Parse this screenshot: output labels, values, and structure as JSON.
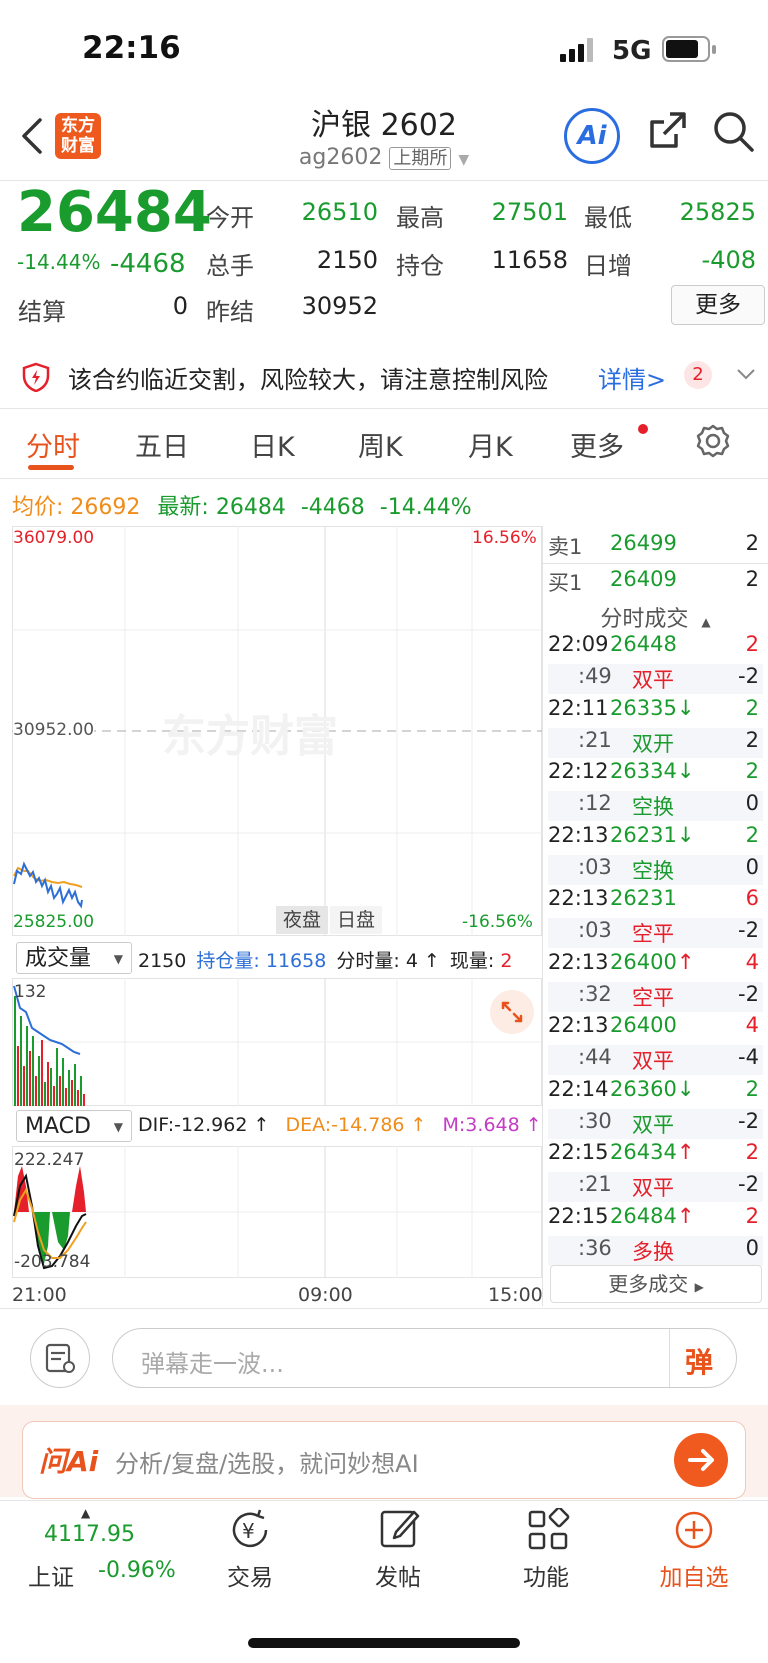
{
  "status_bar": {
    "time": "22:16",
    "network": "5G"
  },
  "header": {
    "logo_text_1": "东方",
    "logo_text_2": "财富",
    "title": "沪银 2602",
    "code": "ag2602",
    "exchange": "上期所",
    "ai_label": "Ai"
  },
  "quote": {
    "price": "26484",
    "change_pct": "-14.44%",
    "change": "-4468",
    "rows": [
      [
        {
          "label": "今开",
          "value": "26510",
          "color": "#1a9b2e"
        },
        {
          "label": "最高",
          "value": "27501",
          "color": "#1a9b2e"
        },
        {
          "label": "最低",
          "value": "25825",
          "color": "#1a9b2e"
        }
      ],
      [
        {
          "label": "总手",
          "value": "2150",
          "color": "#222"
        },
        {
          "label": "持仓",
          "value": "11658",
          "color": "#222"
        },
        {
          "label": "日增",
          "value": "-408",
          "color": "#1a9b2e"
        }
      ]
    ],
    "settle_label": "结算",
    "settle_value": "0",
    "prev_settle_label": "昨结",
    "prev_settle_value": "30952",
    "more_label": "更多"
  },
  "warning": {
    "text": "该合约临近交割，风险较大，请注意控制风险",
    "link": "详情>",
    "badge": "2"
  },
  "tabs": [
    "分时",
    "五日",
    "日K",
    "周K",
    "月K",
    "更多"
  ],
  "info_line": {
    "avg_label": "均价:",
    "avg_value": "26692",
    "latest_label": "最新:",
    "latest_value": "26484",
    "change": "-4468",
    "change_pct": "-14.44%"
  },
  "chart": {
    "max_label": "36079.00",
    "mid_label": "30952.00",
    "min_label": "25825.00",
    "max_pct": "16.56%",
    "min_pct": "-16.56%",
    "watermark": "东方财富",
    "night_label": "夜盘",
    "day_label": "日盘",
    "volume_selector": "成交量",
    "volume_total": "2150",
    "oi_label": "持仓量:",
    "oi_value": "11658",
    "minute_vol_label": "分时量:",
    "minute_vol_value": "4",
    "current_vol_label": "现量:",
    "current_vol_value": "2",
    "volume_max": "132",
    "macd_selector": "MACD",
    "dif": "DIF:-12.962",
    "dea": "DEA:-14.786",
    "m": "M:3.648",
    "macd_max": "222.247",
    "macd_min": "-203.784",
    "time_axis": [
      "21:00",
      "09:00",
      "15:00"
    ]
  },
  "order_book": [
    {
      "side": "卖1",
      "price": "26499",
      "qty": "2"
    },
    {
      "side": "买1",
      "price": "26409",
      "qty": "2"
    }
  ],
  "ticks_header": "分时成交",
  "ticks": [
    {
      "time": "22:09",
      "price": "26448",
      "arrow": "",
      "qty": "2",
      "sec": ":49",
      "type": "双平",
      "oi": "-2",
      "pcolor": "#1a9b2e",
      "tcolor": "#e5202a"
    },
    {
      "time": "22:11",
      "price": "26335",
      "arrow": "↓",
      "qty": "2",
      "sec": ":21",
      "type": "双开",
      "oi": "2",
      "pcolor": "#1a9b2e",
      "tcolor": "#1a9b2e"
    },
    {
      "time": "22:12",
      "price": "26334",
      "arrow": "↓",
      "qty": "2",
      "sec": ":12",
      "type": "空换",
      "oi": "0",
      "pcolor": "#1a9b2e",
      "tcolor": "#1a9b2e"
    },
    {
      "time": "22:13",
      "price": "26231",
      "arrow": "↓",
      "qty": "2",
      "sec": ":03",
      "type": "空换",
      "oi": "0",
      "pcolor": "#1a9b2e",
      "tcolor": "#1a9b2e"
    },
    {
      "time": "22:13",
      "price": "26231",
      "arrow": "",
      "qty": "6",
      "sec": ":03",
      "type": "空平",
      "oi": "-2",
      "pcolor": "#1a9b2e",
      "tcolor": "#e5202a"
    },
    {
      "time": "22:13",
      "price": "26400",
      "arrow": "↑",
      "qty": "4",
      "sec": ":32",
      "type": "空平",
      "oi": "-2",
      "pcolor": "#1a9b2e",
      "tcolor": "#e5202a"
    },
    {
      "time": "22:13",
      "price": "26400",
      "arrow": "",
      "qty": "4",
      "sec": ":44",
      "type": "双平",
      "oi": "-4",
      "pcolor": "#1a9b2e",
      "tcolor": "#e5202a"
    },
    {
      "time": "22:14",
      "price": "26360",
      "arrow": "↓",
      "qty": "2",
      "sec": ":30",
      "type": "双平",
      "oi": "-2",
      "pcolor": "#1a9b2e",
      "tcolor": "#1a9b2e"
    },
    {
      "time": "22:15",
      "price": "26434",
      "arrow": "↑",
      "qty": "2",
      "sec": ":21",
      "type": "双平",
      "oi": "-2",
      "pcolor": "#1a9b2e",
      "tcolor": "#e5202a"
    },
    {
      "time": "22:15",
      "price": "26484",
      "arrow": "↑",
      "qty": "2",
      "sec": ":36",
      "type": "多换",
      "oi": "0",
      "pcolor": "#1a9b2e",
      "tcolor": "#e5202a"
    }
  ],
  "more_trades": "更多成交",
  "danmu": {
    "placeholder": "弹幕走一波...",
    "send": "弹"
  },
  "ask_ai": {
    "brand": "问Ai",
    "placeholder": "分析/复盘/选股，就问妙想AI"
  },
  "bottom_nav": {
    "index_value": "4117.95",
    "index_name": "上证",
    "index_change": "-0.96%",
    "items": [
      "交易",
      "发帖",
      "功能",
      "加自选"
    ]
  }
}
